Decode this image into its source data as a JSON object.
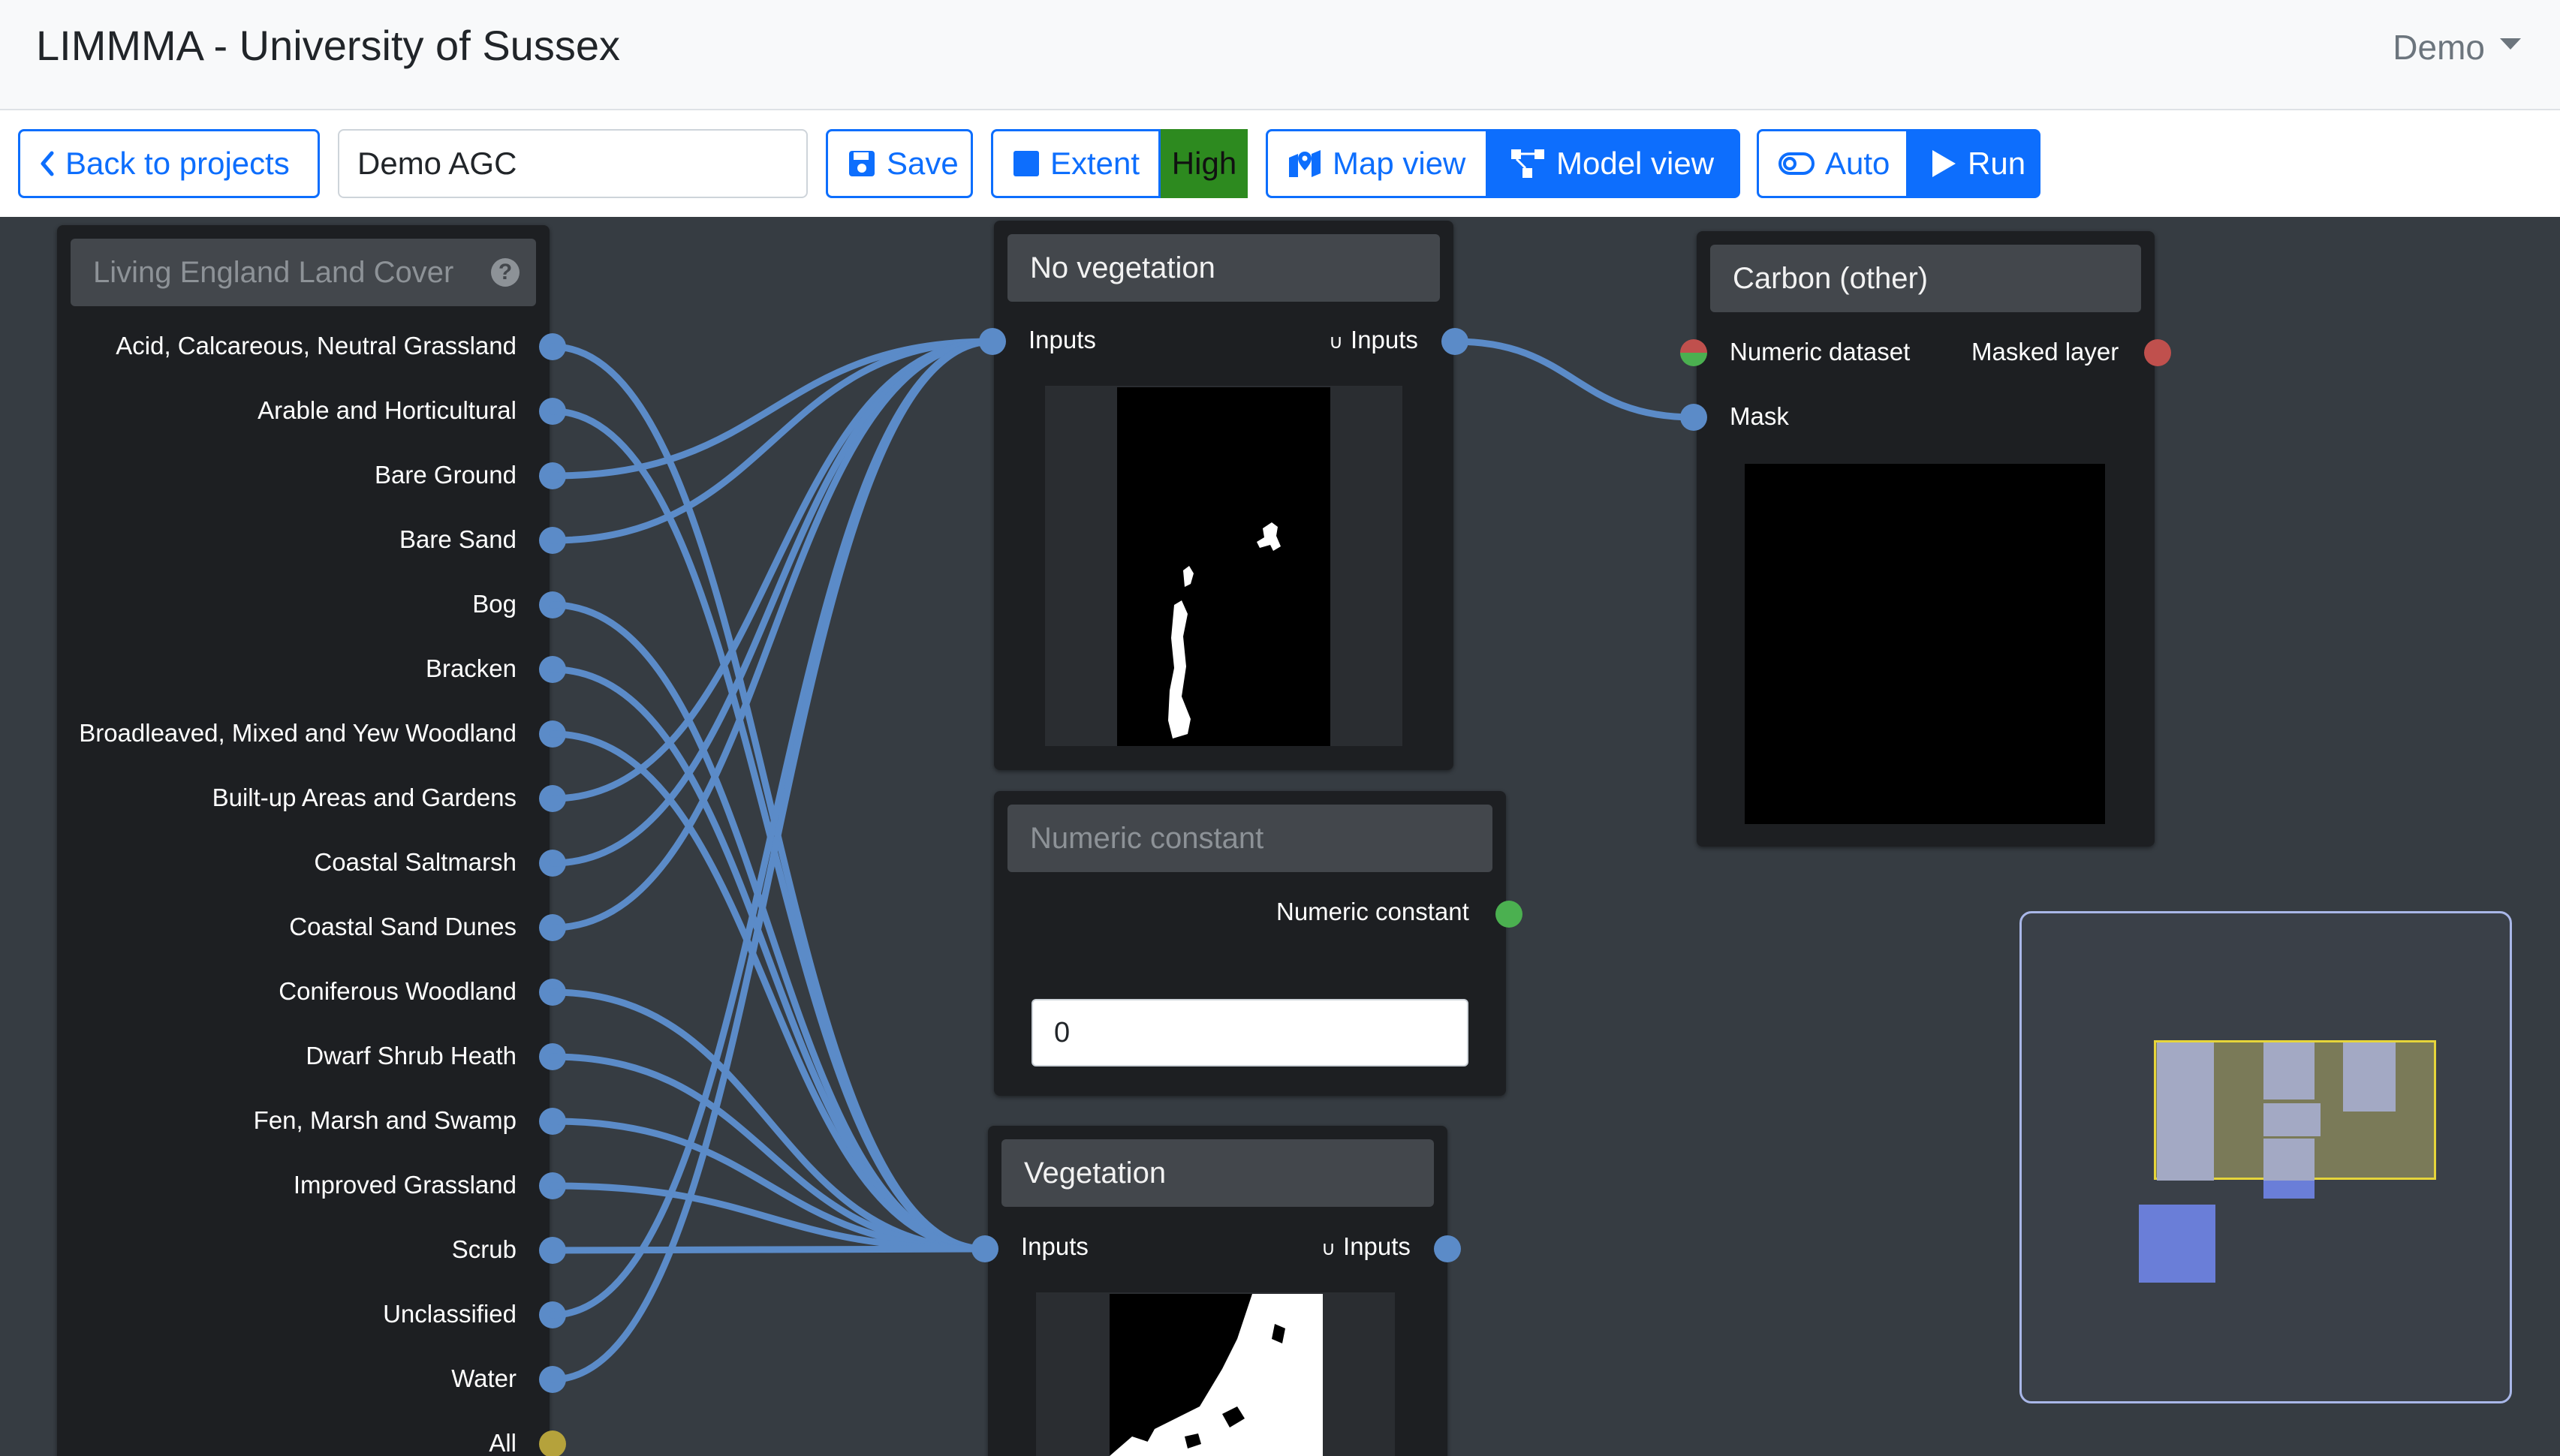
{
  "navbar": {
    "brand": "LIMMMA - University of Sussex",
    "user_menu": "Demo"
  },
  "toolbar": {
    "back_label": "Back to projects",
    "project_name": "Demo AGC",
    "save_label": "Save",
    "extent_label": "Extent",
    "extent_badge": "High",
    "map_view_label": "Map view",
    "model_view_label": "Model view",
    "auto_label": "Auto",
    "run_label": "Run"
  },
  "nodes": {
    "land_cover": {
      "title": "Living England Land Cover",
      "help_icon": "question-circle-icon",
      "outputs": [
        "Acid, Calcareous, Neutral Grassland",
        "Arable and Horticultural",
        "Bare Ground",
        "Bare Sand",
        "Bog",
        "Bracken",
        "Broadleaved, Mixed and Yew Woodland",
        "Built-up Areas and Gardens",
        "Coastal Saltmarsh",
        "Coastal Sand Dunes",
        "Coniferous Woodland",
        "Dwarf Shrub Heath",
        "Fen, Marsh and Swamp",
        "Improved Grassland",
        "Scrub",
        "Unclassified",
        "Water",
        "All"
      ]
    },
    "no_vegetation": {
      "title": "No vegetation",
      "input_label": "Inputs",
      "output_prefix": "∪",
      "output_label": "Inputs"
    },
    "numeric_constant": {
      "title": "Numeric constant",
      "output_label": "Numeric constant",
      "value": "0"
    },
    "vegetation": {
      "title": "Vegetation",
      "input_label": "Inputs",
      "output_prefix": "∪",
      "output_label": "Inputs"
    },
    "carbon_other": {
      "title": "Carbon (other)",
      "input_numeric": "Numeric dataset",
      "input_mask": "Mask",
      "output_label": "Masked layer"
    }
  },
  "colors": {
    "primary": "#0d6efd",
    "canvas": "#363c42",
    "node": "#1d1f22",
    "wire": "#5b8bc8",
    "badge_high": "#2d8a1f",
    "port_numeric": "#4bb050",
    "port_layer": "#c0504d",
    "port_all": "#b5a23b",
    "minimap_viewport": "#e6d53a"
  }
}
